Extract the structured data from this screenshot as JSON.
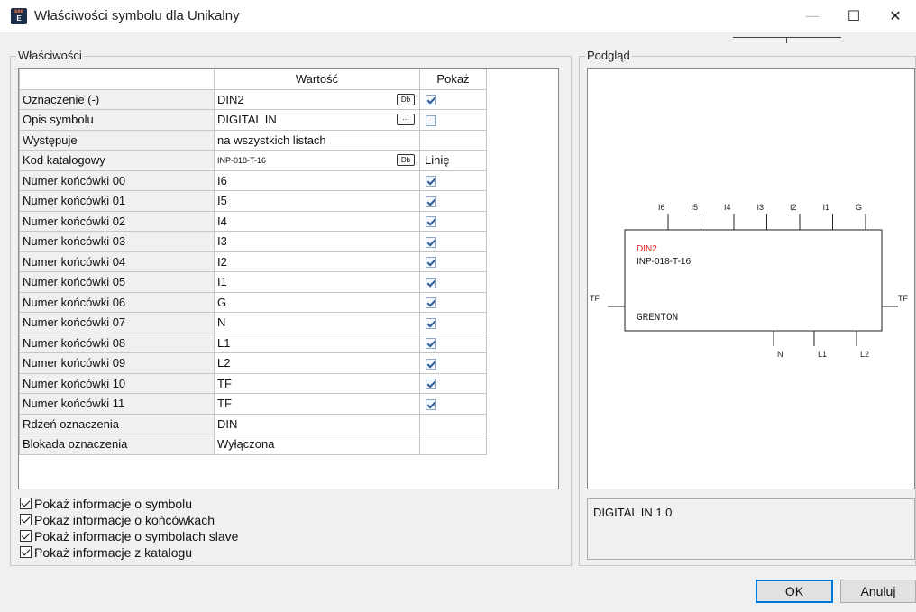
{
  "window": {
    "title": "Właściwości symbolu dla Unikalny",
    "icon_top": "see",
    "icon_bottom": "E",
    "minimize": "—",
    "maximize": "☐",
    "close": "✕"
  },
  "properties": {
    "group_title": "Właściwości",
    "headers": {
      "name": "",
      "value": "Wartość",
      "show": "Pokaż"
    },
    "rows": [
      {
        "name": "Oznaczenie (-)",
        "value": "DIN2",
        "button": "Db",
        "show": "checked"
      },
      {
        "name": "Opis symbolu",
        "value": "DIGITAL IN",
        "button": "···",
        "show": "unchecked"
      },
      {
        "name": "Występuje",
        "value": "na wszystkich listach",
        "button": "",
        "show": "none"
      },
      {
        "name": "Kod katalogowy",
        "value": "INP-018-T-16",
        "button": "Db",
        "show": "text",
        "show_text": "Linię"
      },
      {
        "name": "Numer końcówki 00",
        "value": "I6",
        "button": "",
        "show": "checked"
      },
      {
        "name": "Numer końcówki 01",
        "value": "I5",
        "button": "",
        "show": "checked"
      },
      {
        "name": "Numer końcówki 02",
        "value": "I4",
        "button": "",
        "show": "checked"
      },
      {
        "name": "Numer końcówki 03",
        "value": "I3",
        "button": "",
        "show": "checked"
      },
      {
        "name": "Numer końcówki 04",
        "value": "I2",
        "button": "",
        "show": "checked"
      },
      {
        "name": "Numer końcówki 05",
        "value": "I1",
        "button": "",
        "show": "checked"
      },
      {
        "name": "Numer końcówki 06",
        "value": "G",
        "button": "",
        "show": "checked"
      },
      {
        "name": "Numer końcówki 07",
        "value": "N",
        "button": "",
        "show": "checked"
      },
      {
        "name": "Numer końcówki 08",
        "value": "L1",
        "button": "",
        "show": "checked"
      },
      {
        "name": "Numer końcówki 09",
        "value": "L2",
        "button": "",
        "show": "checked"
      },
      {
        "name": "Numer końcówki 10",
        "value": "TF",
        "button": "",
        "show": "checked"
      },
      {
        "name": "Numer końcówki 11",
        "value": "TF",
        "button": "",
        "show": "checked"
      },
      {
        "name": "Rdzeń oznaczenia",
        "value": "DIN",
        "button": "",
        "show": "none"
      },
      {
        "name": "Blokada oznaczenia",
        "value": "Wyłączona",
        "button": "",
        "show": "none"
      }
    ]
  },
  "options": [
    {
      "label": "Pokaż informacje o symbolu",
      "checked": true
    },
    {
      "label": "Pokaż informacje o końcówkach",
      "checked": true
    },
    {
      "label": "Pokaż informacje o symbolach slave",
      "checked": true
    },
    {
      "label": "Pokaż informacje z katalogu",
      "checked": true
    }
  ],
  "preview": {
    "group_title": "Podgląd",
    "designation": "DIN2",
    "catalog_code": "INP-018-T-16",
    "manufacturer": "GRENTON",
    "top_pins": [
      "I6",
      "I5",
      "I4",
      "I3",
      "I2",
      "I1",
      "G"
    ],
    "bottom_pins": [
      "N",
      "L1",
      "L2"
    ],
    "left_pin": "TF",
    "right_pin": "TF",
    "designation_color": "#e02020"
  },
  "description": "DIGITAL IN 1.0",
  "buttons": {
    "ok": "OK",
    "cancel": "Anuluj"
  }
}
